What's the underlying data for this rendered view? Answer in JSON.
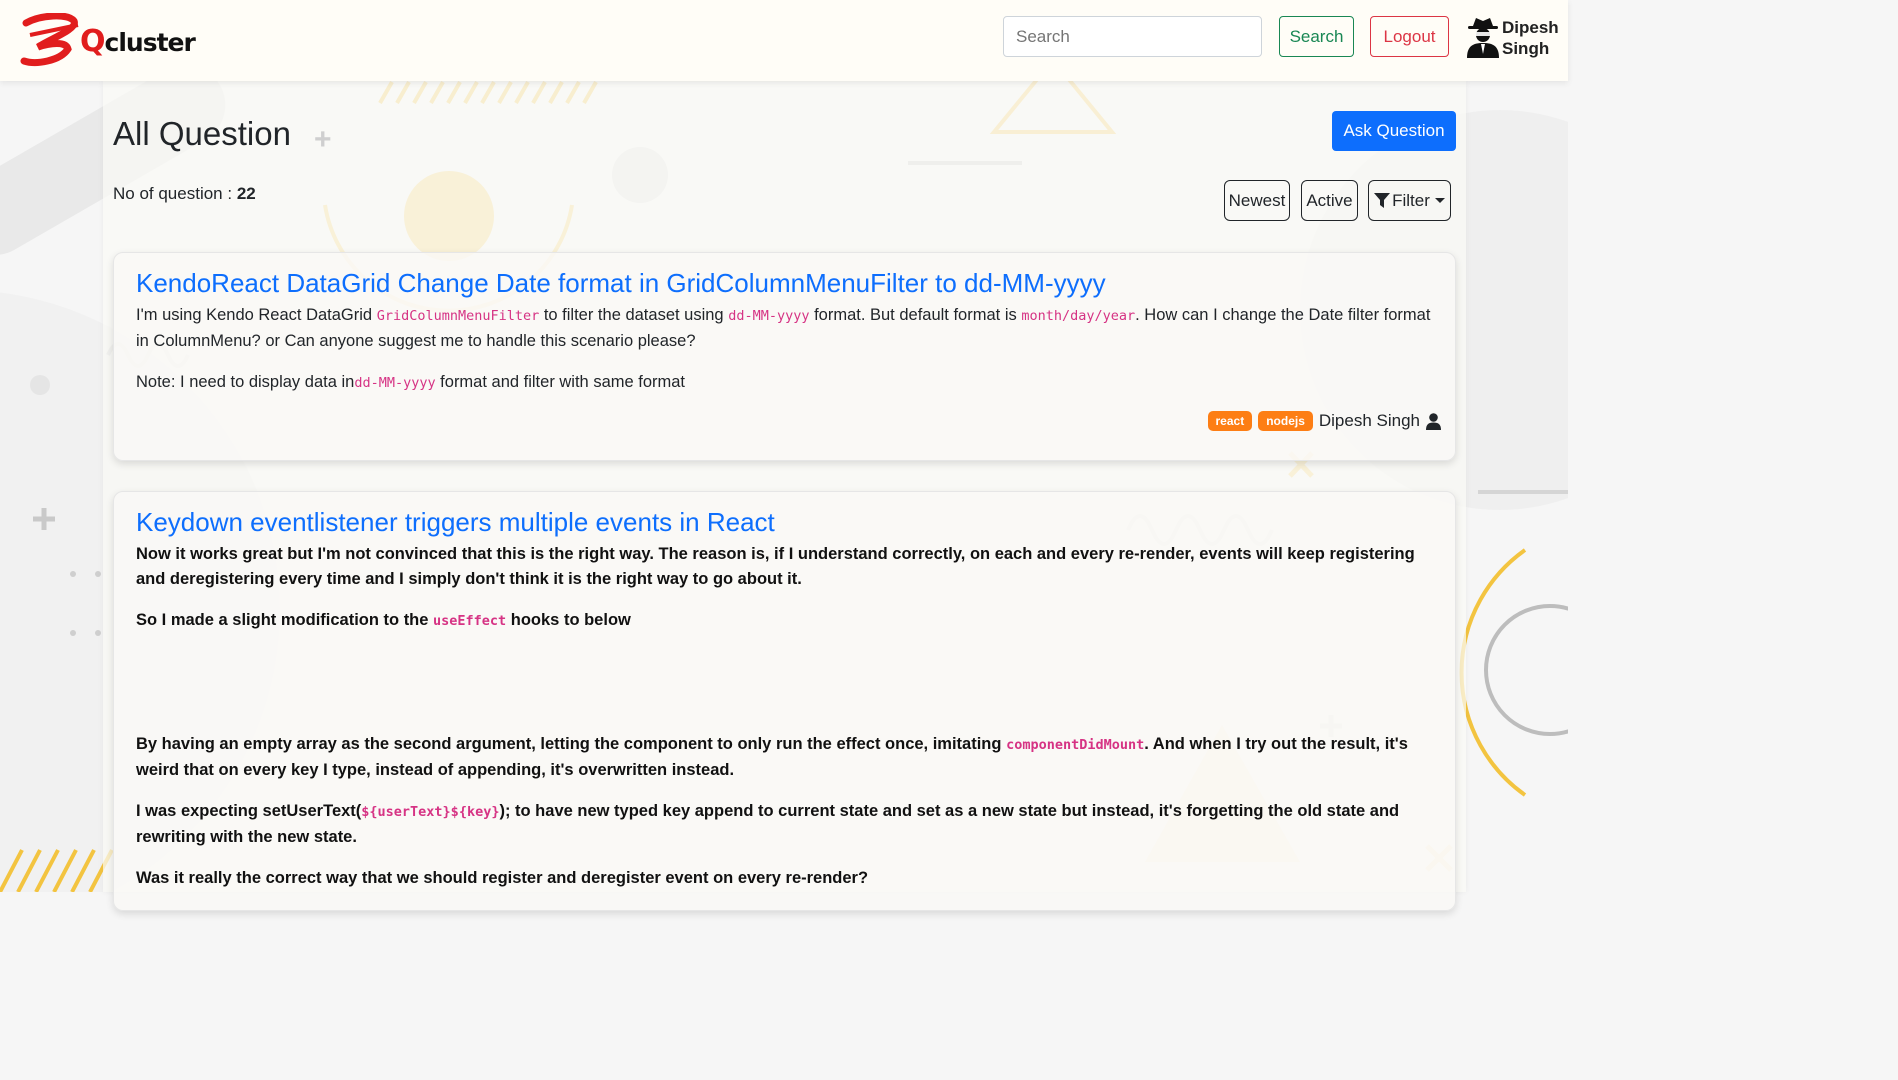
{
  "navbar": {
    "logo_q": "Q",
    "logo_rest": "cluster",
    "search_placeholder": "Search",
    "search_button": "Search",
    "logout_button": "Logout",
    "user_first": "Dipesh",
    "user_last": "Singh"
  },
  "page": {
    "title": "All Question",
    "ask_button": "Ask Question",
    "count_label": "No of question : ",
    "count_value": "22",
    "sort": {
      "newest": "Newest",
      "active": "Active",
      "filter": "Filter"
    }
  },
  "questions": [
    {
      "title": "KendoReact DataGrid Change Date format in GridColumnMenuFilter to dd-MM-yyyy",
      "p1_a": "I'm using Kendo React DataGrid ",
      "p1_code1": "GridColumnMenuFilter",
      "p1_b": " to filter the dataset using ",
      "p1_code2": "dd-MM-yyyy",
      "p1_c": " format. But default format is ",
      "p1_code3": "month/day/year",
      "p1_d": ". How can I change the Date filter format in ColumnMenu? or Can anyone suggest me to handle this scenario please?",
      "p2_a": "Note: I need to display data in",
      "p2_code": "dd-MM-yyyy",
      "p2_b": " format and filter with same format",
      "tags": [
        "react",
        "nodejs"
      ],
      "author": "Dipesh Singh"
    },
    {
      "title": "Keydown eventlistener triggers multiple events in React",
      "p1": "Now it works great but I'm not convinced that this is the right way. The reason is, if I understand correctly, on each and every re-render, events will keep registering and deregistering every time and I simply don't think it is the right way to go about it.",
      "p2_a": "So I made a slight modification to the ",
      "p2_code": "useEffect",
      "p2_b": " hooks to below",
      "p3_a": "By having an empty array as the second argument, letting the component to only run the effect once, imitating ",
      "p3_code": "componentDidMount",
      "p3_b": ". And when I try out the result, it's weird that on every key I type, instead of appending, it's overwritten instead.",
      "p4_a": "I was expecting setUserText(",
      "p4_code": "${userText}${key}",
      "p4_b": "); to have new typed key append to current state and set as a new state but instead, it's forgetting the old state and rewriting with the new state.",
      "p5": "Was it really the correct way that we should register and deregister event on every re-render?"
    }
  ]
}
